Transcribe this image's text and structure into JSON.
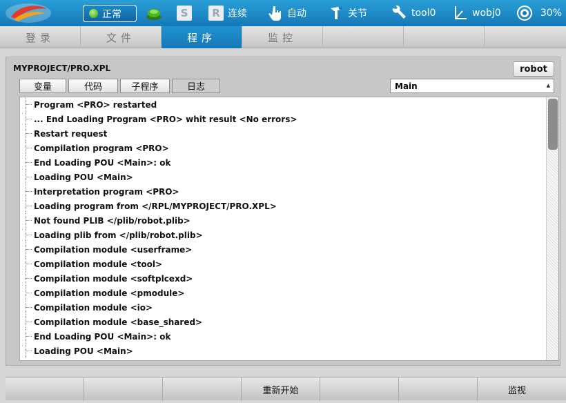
{
  "status_bar": {
    "mode_label": "正常",
    "btn_s": "S",
    "btn_r": "R",
    "continuous_label": "连续",
    "auto_label": "自动",
    "joint_label": "关节",
    "tool_label": "tool0",
    "wobj_label": "wobj0",
    "speed_percent": "30%"
  },
  "tabs": [
    {
      "label": "登录"
    },
    {
      "label": "文件"
    },
    {
      "label": "程序"
    },
    {
      "label": "监控"
    },
    {
      "label": ""
    },
    {
      "label": ""
    },
    {
      "label": ""
    }
  ],
  "program": {
    "path": "MYPROJECT/PRO.XPL",
    "robot_button": "robot",
    "subtabs": [
      "变量",
      "代码",
      "子程序",
      "日志"
    ],
    "selected_pou": "Main"
  },
  "log": [
    "Program <PRO> restarted",
    "... End Loading Program <PRO> whit result <No errors>",
    "Restart request",
    "Compilation program <PRO>",
    "End Loading POU <Main>: ok",
    "Loading POU <Main>",
    "Interpretation program <PRO>",
    "Loading program from </RPL/MYPROJECT/PRO.XPL>",
    "Not found PLIB </plib/robot.plib>",
    "Loading plib from </plib/robot.plib>",
    "Compilation module <userframe>",
    "Compilation module <tool>",
    "Compilation module <softplcexd>",
    "Compilation module <pmodule>",
    "Compilation module <io>",
    "Compilation module <base_shared>",
    "End Loading POU <Main>: ok",
    "Loading POU <Main>"
  ],
  "bottom_bar": [
    "",
    "",
    "",
    "重新开始",
    "",
    "",
    "监视"
  ],
  "colors": {
    "accent_blue": "#1a86c6",
    "panel_gray": "#c7c7c7",
    "status_green": "#4ab81c"
  }
}
